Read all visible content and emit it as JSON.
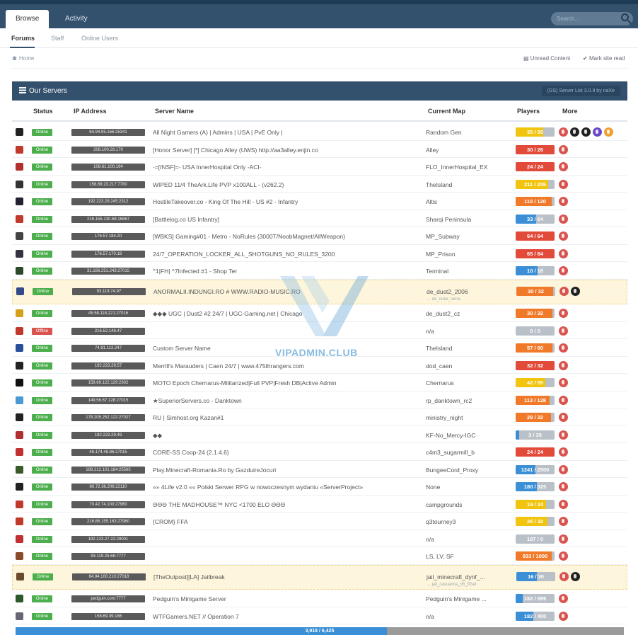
{
  "nav": {
    "tabs": [
      {
        "label": "Browse"
      },
      {
        "label": "Activity"
      }
    ],
    "search_placeholder": "Search...",
    "subtabs": [
      {
        "label": "Forums"
      },
      {
        "label": "Staff"
      },
      {
        "label": "Online Users"
      }
    ]
  },
  "breadcrumb": {
    "home": "Home"
  },
  "toolbar": {
    "unread": "Unread Content",
    "mark_read": "Mark site read"
  },
  "panel": {
    "title": "Our Servers",
    "badge": "(GS) Server List 3.0.9 by naXe"
  },
  "columns": {
    "status": "Status",
    "ip": "IP Address",
    "name": "Server Name",
    "map": "Current Map",
    "players": "Players",
    "more": "More"
  },
  "colors": {
    "online": "#4cae4c",
    "offline": "#d9534f",
    "header": "#33506d",
    "highlight": "#fdf5dc"
  },
  "servers": [
    {
      "status": "Online",
      "ip": "64.94.95.166:25341",
      "name": "All Night Gamers (A) | Admins | USA | PvE Only |",
      "map": "Random Gen",
      "sub": "",
      "players": "35 / 50",
      "ratio": 0.7,
      "icons": [
        "steam",
        "google",
        "video",
        "stats",
        "cart"
      ]
    },
    {
      "status": "Online",
      "ip": "208.100.28.170",
      "name": "[Honor Server] [*] Chicago Alley (UWS) http://aa3alley.enjin.co",
      "map": "Alley",
      "sub": "",
      "players": "30 / 26",
      "ratio": 1,
      "icons": [
        "steam"
      ]
    },
    {
      "status": "Online",
      "ip": "108.61.100.194",
      "name": "-=[INSF]=- USA InnerHospital Only -ACI-",
      "map": "FLO_InnerHospital_EX",
      "sub": "",
      "players": "24 / 24",
      "ratio": 1,
      "icons": [
        "steam"
      ]
    },
    {
      "status": "Online",
      "ip": "158.69.23.217:7780",
      "name": "WIPED 11/4 TheArk.Life PVP x100ALL - (v262.2)",
      "map": "TheIsland",
      "sub": "",
      "players": "211 / 255",
      "ratio": 0.83,
      "icons": [
        "steam"
      ]
    },
    {
      "status": "Online",
      "ip": "192.223.29.245:2312",
      "name": "HostileTakeover.co - King Of The Hill - US #2 - Infantry",
      "map": "Altis",
      "sub": "",
      "players": "110 / 120",
      "ratio": 0.92,
      "icons": [
        "steam"
      ]
    },
    {
      "status": "Online",
      "ip": "216.155.130.68:16667",
      "name": "[Battlelog.co US Infantry]",
      "map": "Sharqi Peninsula",
      "sub": "",
      "players": "33 / 64",
      "ratio": 0.52,
      "icons": [
        "steam"
      ]
    },
    {
      "status": "Online",
      "ip": "176.57.184.20",
      "name": "[WBKS] Gaming#01 - Metro - NoRules (3000T/NoobMagnet/AllWeapon)",
      "map": "MP_Subway",
      "sub": "",
      "players": "64 / 64",
      "ratio": 1,
      "icons": [
        "steam"
      ]
    },
    {
      "status": "Online",
      "ip": "176.57.170.18",
      "name": "24/7_OPERATION_LOCKER_ALL_SHOTGUNS_NO_RULES_3200",
      "map": "MP_Prison",
      "sub": "",
      "players": "65 / 64",
      "ratio": 1,
      "icons": [
        "steam"
      ]
    },
    {
      "status": "Online",
      "ip": "31.186.251.243:27015",
      "name": "^1|FH| ^7Infected #1 - Shop Ter",
      "map": "Terminal",
      "sub": "",
      "players": "10 / 18",
      "ratio": 0.56,
      "icons": [
        "steam"
      ]
    },
    {
      "status": "Online",
      "ip": "53.119.74.97",
      "name": "ANORMALII.INDUNGI.RO # WWW.RADIO-MUSIC.RO",
      "map": "de_dust2_2006",
      "sub": "→ de_nuke_torna",
      "players": "30 / 32",
      "ratio": 0.94,
      "icons": [
        "steam",
        "google"
      ]
    },
    {
      "status": "Online",
      "ip": "45.58.118.221:27016",
      "name": "◆◆◆ UGC | Dust2 #2 24/7 | UGC-Gaming.net | Chicago",
      "map": "de_dust2_cz",
      "sub": "",
      "players": "30 / 32",
      "ratio": 0.94,
      "icons": [
        "steam"
      ]
    },
    {
      "status": "Offline",
      "ip": "216.52.148.47",
      "name": "",
      "map": "n/a",
      "sub": "",
      "players": "0 / 0",
      "ratio": 0,
      "icons": [
        "steam"
      ]
    },
    {
      "status": "Online",
      "ip": "74.91.112.247",
      "name": "Custom Server Name",
      "map": "TheIsland",
      "sub": "",
      "players": "57 / 60",
      "ratio": 0.95,
      "icons": [
        "steam"
      ]
    },
    {
      "status": "Online",
      "ip": "192.223.29.57",
      "name": "Merrill's Marauders | Caen 24/7 | www.475thrangers.com",
      "map": "dod_caen",
      "sub": "",
      "players": "32 / 32",
      "ratio": 1,
      "icons": [
        "steam"
      ]
    },
    {
      "status": "Online",
      "ip": "158.69.122.129:2302",
      "name": "MOTO Epoch Chernarus-Militarized|Full PVP|Fresh DB|Active Admin",
      "map": "Chernarus",
      "sub": "",
      "players": "42 / 55",
      "ratio": 0.76,
      "icons": [
        "steam"
      ]
    },
    {
      "status": "Online",
      "ip": "149.56.67.128:27015",
      "name": "★SuperiorServers.co - Danktown",
      "map": "rp_danktown_rc2",
      "sub": "",
      "players": "113 / 128",
      "ratio": 0.88,
      "icons": [
        "steam"
      ]
    },
    {
      "status": "Online",
      "ip": "178.205.252.122:27027",
      "name": "RU | Simhost.org Kazan#1",
      "map": "ministry_night",
      "sub": "",
      "players": "29 / 32",
      "ratio": 0.9,
      "icons": [
        "steam"
      ]
    },
    {
      "status": "Online",
      "ip": "192.223.29.49",
      "name": "◆◆",
      "map": "KF-No_Mercy-IGC",
      "sub": "",
      "players": "3 / 35",
      "ratio": 0.09,
      "icons": [
        "steam"
      ]
    },
    {
      "status": "Online",
      "ip": "46.174.48.86:27015",
      "name": "CORE-SS Coop-24 (2.1.4.6)",
      "map": "c4m3_sugarmill_b",
      "sub": "",
      "players": "24 / 24",
      "ratio": 1,
      "icons": [
        "steam"
      ]
    },
    {
      "status": "Online",
      "ip": "188.212.101.184:25565",
      "name": "Play.Minecraft-Romania.Ro by GazduireJocuri",
      "map": "BungeeCord_Proxy",
      "sub": "",
      "players": "1241 / 2500",
      "ratio": 0.5,
      "icons": [
        "steam"
      ]
    },
    {
      "status": "Online",
      "ip": "80.72.36.206:22110",
      "name": "»» 4Life v2.0 «« Polski Serwer RPG w nowoczesnym wydaniu «ServerProject»",
      "map": "None",
      "sub": "",
      "players": "180 / 325",
      "ratio": 0.55,
      "icons": [
        "steam"
      ]
    },
    {
      "status": "Online",
      "ip": "70.42.74.100:27960",
      "name": "ΘΘΘ THE MADHOUSE™ NYC <1700 ELO ΘΘΘ",
      "map": "campgrounds",
      "sub": "",
      "players": "19 / 24",
      "ratio": 0.79,
      "icons": [
        "steam"
      ]
    },
    {
      "status": "Online",
      "ip": "216.86.155.163:27960",
      "name": "{CROM} FFA",
      "map": "q3tourney3",
      "sub": "",
      "players": "26 / 32",
      "ratio": 0.81,
      "icons": [
        "steam"
      ]
    },
    {
      "status": "Online",
      "ip": "192.223.27.22:28001",
      "name": "",
      "map": "n/a",
      "sub": "",
      "players": "197 / 0",
      "ratio": 0,
      "icons": [
        "steam"
      ]
    },
    {
      "status": "Online",
      "ip": "93.119.25.66:7777",
      "name": "",
      "map": "LS, LV, SF",
      "sub": "",
      "players": "933 / 1000",
      "ratio": 0.93,
      "icons": [
        "steam"
      ]
    },
    {
      "status": "Online",
      "ip": "64.94.100.210:27018",
      "name": "[TheOutpost][LA] Jailbreak",
      "map": "jail_minecraft_dynf_...",
      "sub": "→ jail_casuarina_b5_ff2all",
      "players": "16 / 30",
      "ratio": 0.53,
      "icons": [
        "steam",
        "google"
      ]
    },
    {
      "status": "Online",
      "ip": "pedguin.com:7777",
      "name": "Pedguin's Minigame Server",
      "map": "Pedguin's Minigame ...",
      "sub": "",
      "players": "182 / 999",
      "ratio": 0.18,
      "icons": [
        "steam"
      ]
    },
    {
      "status": "Online",
      "ip": "158.69.39.186",
      "name": "WTFGamers.NET // Operation 7",
      "map": "n/a",
      "sub": "",
      "players": "182 / 400",
      "ratio": 0.46,
      "icons": [
        "steam"
      ]
    }
  ],
  "total": {
    "label": "3,918 / 6,425",
    "ratio": 0.61
  },
  "watermark": "VIPADMIN.CLUB"
}
